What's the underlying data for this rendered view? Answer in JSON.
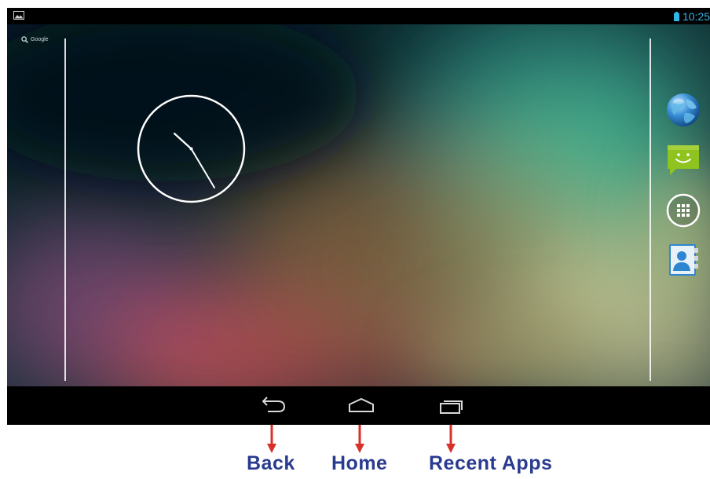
{
  "status_bar": {
    "time": "10:25",
    "left_icon": "gallery-notification-icon",
    "battery_icon": "battery-icon"
  },
  "home_screen": {
    "search_widget": {
      "label": "Google",
      "icon": "search-icon"
    },
    "clock_widget": {
      "type": "analog",
      "hour_hand_time": "10:25"
    },
    "hotseat": [
      {
        "name": "browser-icon"
      },
      {
        "name": "messaging-icon"
      },
      {
        "name": "all-apps-icon"
      },
      {
        "name": "contacts-icon"
      }
    ]
  },
  "navigation_bar": {
    "buttons": [
      {
        "name": "back-button",
        "icon": "back-arrow-icon"
      },
      {
        "name": "home-button",
        "icon": "home-house-icon"
      },
      {
        "name": "recent-apps-button",
        "icon": "recent-apps-icon"
      }
    ]
  },
  "annotations": {
    "back_label": "Back",
    "home_label": "Home",
    "recent_label": "Recent Apps",
    "arrow_color": "#d8302a",
    "label_color": "#2a3b8f"
  },
  "colors": {
    "status_accent": "#33b5e5",
    "bar_background": "#000000"
  }
}
